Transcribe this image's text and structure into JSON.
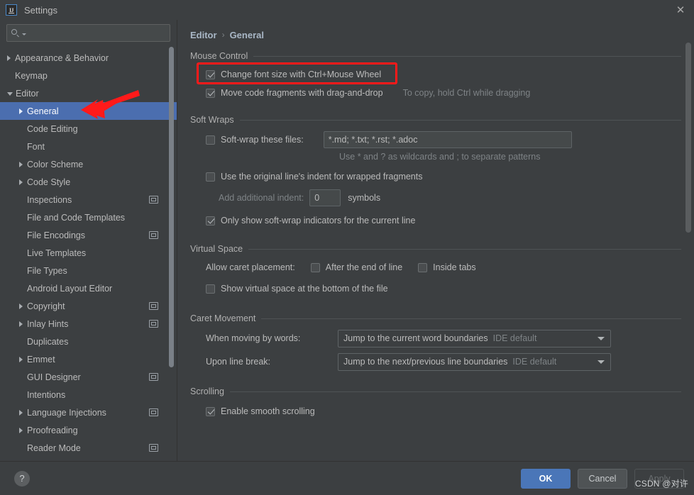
{
  "window": {
    "title": "Settings",
    "logo_text": "IJ",
    "close_label": "✕"
  },
  "search": {
    "value": "",
    "placeholder": ""
  },
  "sidebar": {
    "items": [
      {
        "label": "Appearance & Behavior",
        "arrow": "collapsed",
        "level": 0,
        "selected": false,
        "scope_icon": false
      },
      {
        "label": "Keymap",
        "arrow": "none",
        "level": 0,
        "selected": false,
        "scope_icon": false
      },
      {
        "label": "Editor",
        "arrow": "expanded",
        "level": 0,
        "selected": false,
        "scope_icon": false
      },
      {
        "label": "General",
        "arrow": "collapsed",
        "level": 1,
        "selected": true,
        "scope_icon": false
      },
      {
        "label": "Code Editing",
        "arrow": "none",
        "level": 1,
        "selected": false,
        "scope_icon": false
      },
      {
        "label": "Font",
        "arrow": "none",
        "level": 1,
        "selected": false,
        "scope_icon": false
      },
      {
        "label": "Color Scheme",
        "arrow": "collapsed",
        "level": 1,
        "selected": false,
        "scope_icon": false
      },
      {
        "label": "Code Style",
        "arrow": "collapsed",
        "level": 1,
        "selected": false,
        "scope_icon": false
      },
      {
        "label": "Inspections",
        "arrow": "none",
        "level": 1,
        "selected": false,
        "scope_icon": true
      },
      {
        "label": "File and Code Templates",
        "arrow": "none",
        "level": 1,
        "selected": false,
        "scope_icon": false
      },
      {
        "label": "File Encodings",
        "arrow": "none",
        "level": 1,
        "selected": false,
        "scope_icon": true
      },
      {
        "label": "Live Templates",
        "arrow": "none",
        "level": 1,
        "selected": false,
        "scope_icon": false
      },
      {
        "label": "File Types",
        "arrow": "none",
        "level": 1,
        "selected": false,
        "scope_icon": false
      },
      {
        "label": "Android Layout Editor",
        "arrow": "none",
        "level": 1,
        "selected": false,
        "scope_icon": false
      },
      {
        "label": "Copyright",
        "arrow": "collapsed",
        "level": 1,
        "selected": false,
        "scope_icon": true
      },
      {
        "label": "Inlay Hints",
        "arrow": "collapsed",
        "level": 1,
        "selected": false,
        "scope_icon": true
      },
      {
        "label": "Duplicates",
        "arrow": "none",
        "level": 1,
        "selected": false,
        "scope_icon": false
      },
      {
        "label": "Emmet",
        "arrow": "collapsed",
        "level": 1,
        "selected": false,
        "scope_icon": false
      },
      {
        "label": "GUI Designer",
        "arrow": "none",
        "level": 1,
        "selected": false,
        "scope_icon": true
      },
      {
        "label": "Intentions",
        "arrow": "none",
        "level": 1,
        "selected": false,
        "scope_icon": false
      },
      {
        "label": "Language Injections",
        "arrow": "collapsed",
        "level": 1,
        "selected": false,
        "scope_icon": true
      },
      {
        "label": "Proofreading",
        "arrow": "collapsed",
        "level": 1,
        "selected": false,
        "scope_icon": false
      },
      {
        "label": "Reader Mode",
        "arrow": "none",
        "level": 1,
        "selected": false,
        "scope_icon": true
      }
    ]
  },
  "breadcrumb": {
    "root": "Editor",
    "separator": "›",
    "leaf": "General"
  },
  "sections": {
    "mouse_control": {
      "title": "Mouse Control",
      "change_font_size": {
        "label": "Change font size with Ctrl+Mouse Wheel",
        "checked": true
      },
      "move_code_fragments": {
        "label": "Move code fragments with drag-and-drop",
        "checked": true
      },
      "drag_hint": "To copy, hold Ctrl while dragging"
    },
    "soft_wraps": {
      "title": "Soft Wraps",
      "soft_wrap_files": {
        "label": "Soft-wrap these files:",
        "checked": false
      },
      "files_value": "*.md; *.txt; *.rst; *.adoc",
      "wildcard_hint": "Use * and ? as wildcards and ; to separate patterns",
      "use_original_indent": {
        "label": "Use the original line's indent for wrapped fragments",
        "checked": false
      },
      "additional_indent_label": "Add additional indent:",
      "additional_indent_value": "0",
      "symbols_label": "symbols",
      "only_show_indicators": {
        "label": "Only show soft-wrap indicators for the current line",
        "checked": true
      }
    },
    "virtual_space": {
      "title": "Virtual Space",
      "allow_caret_label": "Allow caret placement:",
      "after_end_of_line": {
        "label": "After the end of line",
        "checked": false
      },
      "inside_tabs": {
        "label": "Inside tabs",
        "checked": false
      },
      "show_virtual_space": {
        "label": "Show virtual space at the bottom of the file",
        "checked": false
      }
    },
    "caret_movement": {
      "title": "Caret Movement",
      "when_moving_label": "When moving by words:",
      "when_moving_value": "Jump to the current word boundaries",
      "when_moving_sub": "IDE default",
      "upon_line_break_label": "Upon line break:",
      "upon_line_break_value": "Jump to the next/previous line boundaries",
      "upon_line_break_sub": "IDE default"
    },
    "scrolling": {
      "title": "Scrolling",
      "enable_smooth": {
        "label": "Enable smooth scrolling",
        "checked": true
      }
    }
  },
  "footer": {
    "help_label": "?",
    "ok_label": "OK",
    "cancel_label": "Cancel",
    "apply_label": "Apply"
  },
  "watermark": {
    "text": "CSDN @对许"
  },
  "colors": {
    "background": "#3c3f41",
    "selection": "#4b6eaf",
    "accent_button": "#4a76b8",
    "annotation_red": "#ff1a1a",
    "text": "#bbbbbb",
    "muted_text": "#7e8386"
  }
}
